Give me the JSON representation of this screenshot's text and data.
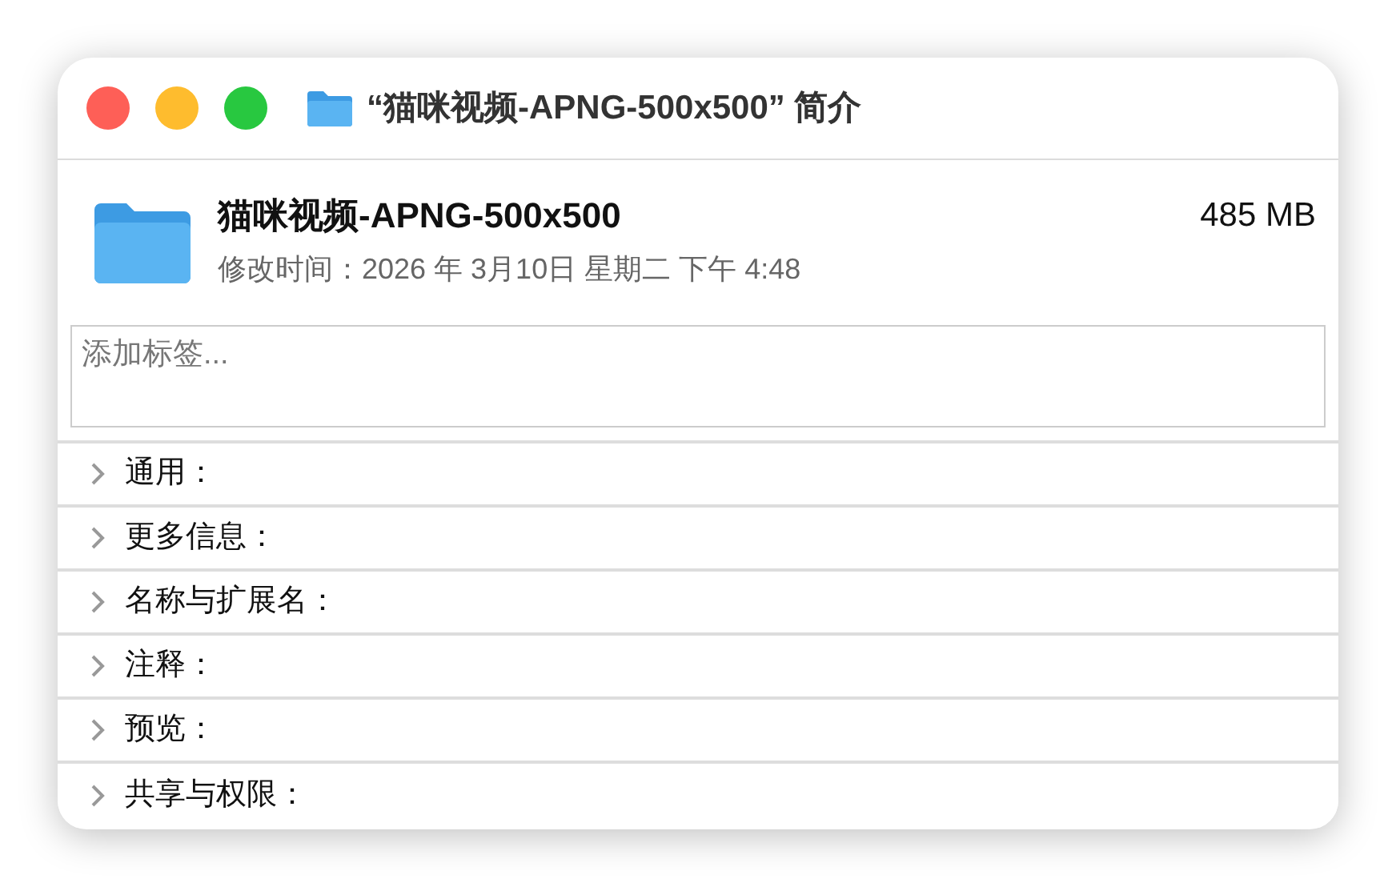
{
  "window": {
    "title": "“猫咪视频-APNG-500x500” 简介"
  },
  "file": {
    "name": "猫咪视频-APNG-500x500",
    "size": "485 MB",
    "modified": "修改时间：2026 年 3月10日 星期二 下午 4:48"
  },
  "tags_field": {
    "placeholder": "添加标签..."
  },
  "sections": [
    {
      "label": "通用：",
      "expanded": false
    },
    {
      "label": "更多信息：",
      "expanded": false
    },
    {
      "label": "名称与扩展名：",
      "expanded": false
    },
    {
      "label": "注释：",
      "expanded": false
    },
    {
      "label": "预览：",
      "expanded": false
    },
    {
      "label": "共享与权限：",
      "expanded": false
    }
  ]
}
